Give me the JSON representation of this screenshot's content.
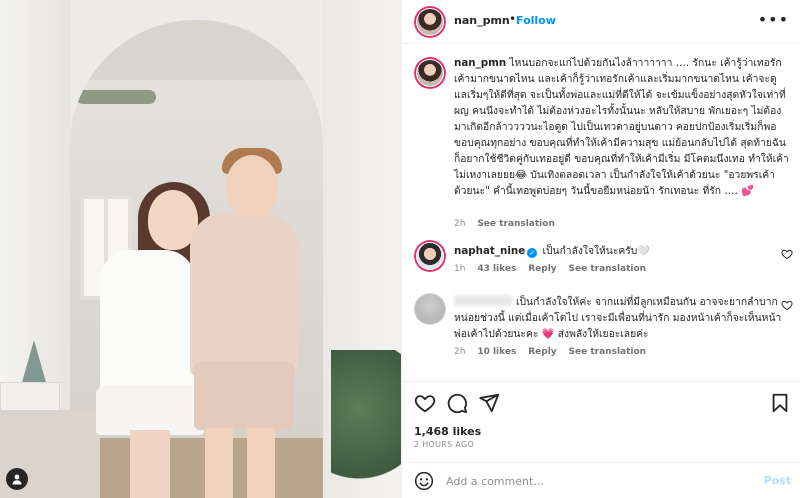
{
  "post": {
    "author": "nan_pmn",
    "follow_label": "Follow",
    "dot": "•",
    "more_label": "•••"
  },
  "caption": {
    "username": "nan_pmn",
    "text": "ไหนบอกจะแก่ไปด้วยกันไงล้าาาาาาา …. รักนะ เค้ารู้ว่าเทอรักเค้ามากขนาดไหน และเค้าก็รู้ว่าเทอรักเค้าและเริ่มมากขนาดไหน เค้าจะดูแลเริ่มๆให้ดีที่สุด จะเป็นทั้งพ่อและแม่ที่ดีให้ได้ จะเข้มแข็งอย่างสุดหัวใจเท่าที่ผญ คนนึงจะทำได้ ไม่ต้องห่วงอะไรทั้งนั้นนะ หลับให้สบาย พักเยอะๆ ไม่ต้องมาเกิดอีกล้าววววนะไอดูด ไปเป็นเทวดาอยู่บนดาว คอยปกป้องเริ่มเริ่มก็พอ ขอบคุณทุกอย่าง ขอบคุณที่ทำให้เค้ามีความสุข แม่ย้อนกลับไปได้ สุดท้ายฉันก็อยากใช้ชีวิตคู่กับเทออยู่ดี ขอบคุณที่ทำให้เค้ามีเริ่ม มีโคตมนึงเทอ ทำให้เค้าไม่เหงาเลยยย",
    "text_tail": " บันเทิงตลอดเวลา เป็นกำลังใจให้เค้าด้วยนะ \"อวยพรเค้าด้วยนะ\" คำนี้เทอพูดบ่อยๆ วันนี้ขอยืมหน่อยน้า รักเทอนะ ที่รัก …. ",
    "emoji_1": "😂",
    "emoji_2": "💕",
    "time": "2h",
    "see_translation": "See translation"
  },
  "comments": [
    {
      "username": "naphat_nine",
      "verified_mark": "✓",
      "text": "เป็นกำลังใจให้นะครับ",
      "emoji": "🤍",
      "time": "1h",
      "likes": "43 likes",
      "reply": "Reply",
      "see_translation": "See translation"
    },
    {
      "username": "",
      "text": "เป็นกำลังใจให้ค่ะ จากแม่ที่มีลูกเหมือนกัน อาจจะยากลำบากหน่อยช่วงนี้ แต่เมื่อเค้าโตไป เราจะมีเพื่อนที่น่ารัก มองหน้าเค้าก็จะเห็นหน้าพ่อเค้าไปด้วยนะคะ",
      "text_tail": " ส่งพลังให้เยอะเลยค่ะ",
      "emoji": "💗",
      "time": "2h",
      "likes": "10 likes",
      "reply": "Reply",
      "see_translation": "See translation"
    }
  ],
  "likes_count": "1,468 likes",
  "posted_ago": "2 HOURS AGO",
  "add_comment": {
    "placeholder": "Add a comment…",
    "post_label": "Post"
  },
  "colors": {
    "link_blue": "#0095f6",
    "heart_red": "#ed4956",
    "muted_gray": "#8e8e8e"
  },
  "icons": [
    "heart-icon",
    "comment-icon",
    "share-icon",
    "bookmark-icon",
    "emoji-icon",
    "more-icon",
    "user-tag-icon",
    "verified-icon"
  ]
}
